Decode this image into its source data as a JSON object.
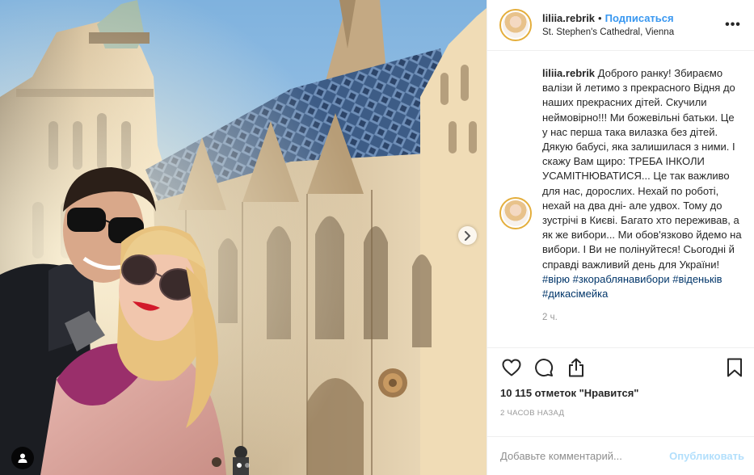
{
  "post": {
    "username": "liliia.rebrik",
    "separator": "•",
    "follow_label": "Подписаться",
    "location": "St. Stephen's Cathedral, Vienna",
    "more_label": "•••"
  },
  "caption": {
    "username": "liliia.rebrik",
    "text": "Доброго ранку! Збираємо валізи й летимо з прекрасного Відня до наших прекрасних дітей. Скучили неймовірно!!! Ми божевільні батьки. Це у нас перша така вилазка без дітей. Дякую бабусі, яка залишилася з ними. І скажу Вам щиро: ТРЕБА ІНКОЛИ УСАМІТНЮВАТИСЯ... Це так важливо для нас, дорослих. Нехай по роботі, нехай на два дні- але удвох. Тому до зустрічі в Києві. Багато хто переживав, а як же вибори... Ми обов'язково йдемо на вибори. І Ви не полінуйтеся! Сьогодні й справді важливий день для України!",
    "hashtags": [
      "#вірю",
      "#зкораблянавибори",
      "#віденьків",
      "#дикасімейка"
    ],
    "time_ago": "2 ч."
  },
  "icons": {
    "like": "heart-icon",
    "comment": "comment-icon",
    "share": "share-icon",
    "save": "bookmark-icon",
    "next": "chevron-right-icon",
    "tags": "user-tag-icon"
  },
  "engagement": {
    "likes_text": "10 115 отметок \"Нравится\"",
    "date_text": "2 ЧАСОВ НАЗАД"
  },
  "comment_form": {
    "placeholder": "Добавьте комментарий...",
    "post_label": "Опубликовать"
  },
  "carousel": {
    "slide_count": 2,
    "active_index": 0
  },
  "colors": {
    "link_blue": "#3897f0",
    "hashtag": "#003569",
    "post_button_disabled": "#b2dffc",
    "story_ring": "#e4ae3c"
  }
}
